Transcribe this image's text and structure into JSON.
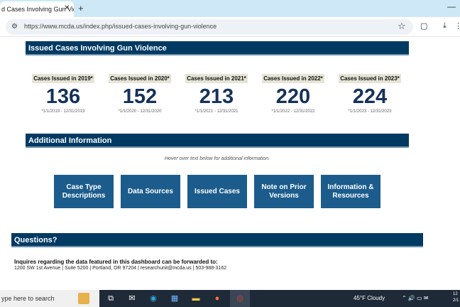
{
  "browser": {
    "tab_title": "d Cases Involving Gun Vio",
    "tab_close": "✕",
    "new_tab": "+",
    "url": "https://www.mcda.us/index.php/issued-cases-involving-gun-violence",
    "window_min": "—"
  },
  "page": {
    "section1_title": "Issued Cases Involving Gun Violence",
    "stats": [
      {
        "label": "Cases Issued in 2019*",
        "value": "136",
        "range": "*1/1/2019 - 12/31/2019"
      },
      {
        "label": "Cases Issued in 2020*",
        "value": "152",
        "range": "*1/1/2020 - 12/31/2020"
      },
      {
        "label": "Cases Issued in 2021*",
        "value": "213",
        "range": "*1/1/2021 - 12/31/2021"
      },
      {
        "label": "Cases Issued in 2022*",
        "value": "220",
        "range": "*1/1/2022 - 12/31/2022"
      },
      {
        "label": "Cases Issued in 2023*",
        "value": "224",
        "range": "*1/1/2023 - 12/31/2023"
      }
    ],
    "section2_title": "Additional Information",
    "hover_note": "Hover over text below for additional information.",
    "buttons": [
      "Case Type Descriptions",
      "Data Sources",
      "Issued Cases",
      "Note on Prior Versions",
      "Information & Resources"
    ],
    "section3_title": "Questions?",
    "inquiry_text": "Inquires regarding the data featured in this dashboard can be forwarded to:",
    "contact_text": "1200 SW 1st Avenue  |  Suite 5200  |  Portland, OR 97204  |  researchunit@mcda.us  |  503-988-3162"
  },
  "taskbar": {
    "search_placeholder": "ype here to search",
    "weather": "45°F  Cloudy",
    "clock_time": "12",
    "clock_date": "2/1"
  },
  "colors": {
    "header_bar": "#003a63",
    "button": "#1b5c8c",
    "stat_value": "#14325a",
    "tabbar": "#cfe8f7",
    "taskbar": "#1f2a38"
  }
}
